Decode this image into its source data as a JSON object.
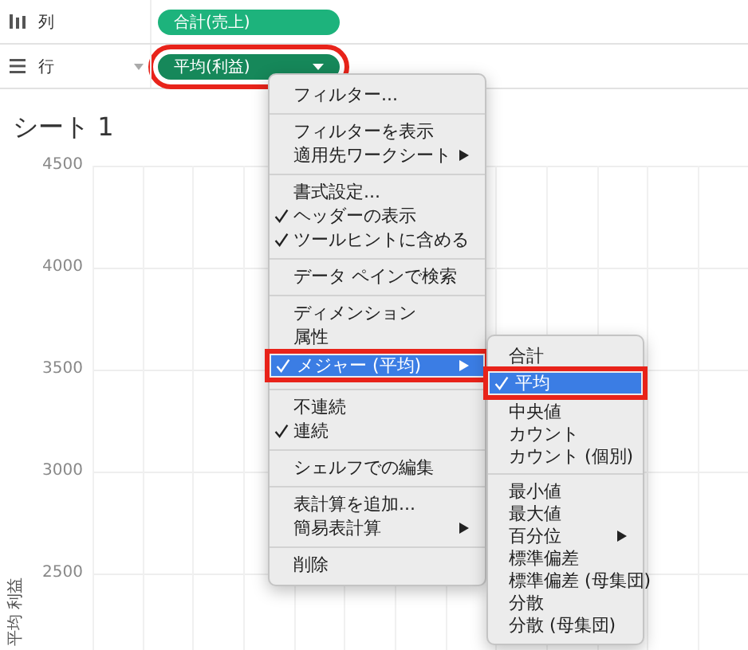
{
  "shelves": [
    {
      "kind": "columns",
      "label": "列",
      "pill": {
        "label": "合計(売上)",
        "dropdown": false,
        "callout": false
      }
    },
    {
      "kind": "rows",
      "label": "行",
      "pill": {
        "label": "平均(利益)",
        "dropdown": true,
        "callout": true
      }
    }
  ],
  "sheet": {
    "title": "シート 1"
  },
  "chart": {
    "y_label": "平均 利益",
    "y_ticks": [
      "4500",
      "4000",
      "3500",
      "3000",
      "2500"
    ]
  },
  "context_menu": {
    "groups": [
      [
        {
          "label": "フィルター...",
          "checked": false,
          "submenu": false,
          "selected": false,
          "callout": false
        }
      ],
      [
        {
          "label": "フィルターを表示",
          "checked": false,
          "submenu": false,
          "selected": false,
          "callout": false
        },
        {
          "label": "適用先ワークシート",
          "checked": false,
          "submenu": true,
          "selected": false,
          "callout": false
        }
      ],
      [
        {
          "label": "書式設定...",
          "checked": false,
          "submenu": false,
          "selected": false,
          "callout": false
        },
        {
          "label": "ヘッダーの表示",
          "checked": true,
          "submenu": false,
          "selected": false,
          "callout": false
        },
        {
          "label": "ツールヒントに含める",
          "checked": true,
          "submenu": false,
          "selected": false,
          "callout": false
        }
      ],
      [
        {
          "label": "データ ペインで検索",
          "checked": false,
          "submenu": false,
          "selected": false,
          "callout": false
        }
      ],
      [
        {
          "label": "ディメンション",
          "checked": false,
          "submenu": false,
          "selected": false,
          "callout": false
        },
        {
          "label": "属性",
          "checked": false,
          "submenu": false,
          "selected": false,
          "callout": false
        },
        {
          "label": "メジャー (平均)",
          "checked": true,
          "submenu": true,
          "selected": true,
          "callout": true
        }
      ],
      [
        {
          "label": "不連続",
          "checked": false,
          "submenu": false,
          "selected": false,
          "callout": false
        },
        {
          "label": "連続",
          "checked": true,
          "submenu": false,
          "selected": false,
          "callout": false
        }
      ],
      [
        {
          "label": "シェルフでの編集",
          "checked": false,
          "submenu": false,
          "selected": false,
          "callout": false
        }
      ],
      [
        {
          "label": "表計算を追加...",
          "checked": false,
          "submenu": false,
          "selected": false,
          "callout": false
        },
        {
          "label": "簡易表計算",
          "checked": false,
          "submenu": true,
          "selected": false,
          "callout": false
        }
      ],
      [
        {
          "label": "削除",
          "checked": false,
          "submenu": false,
          "selected": false,
          "callout": false
        }
      ]
    ]
  },
  "submenu": {
    "groups": [
      [
        {
          "label": "合計",
          "checked": false,
          "submenu": false,
          "selected": false,
          "callout": false
        },
        {
          "label": "平均",
          "checked": true,
          "submenu": false,
          "selected": true,
          "callout": true
        },
        {
          "label": "中央値",
          "checked": false,
          "submenu": false,
          "selected": false,
          "callout": false
        },
        {
          "label": "カウント",
          "checked": false,
          "submenu": false,
          "selected": false,
          "callout": false
        },
        {
          "label": "カウント (個別)",
          "checked": false,
          "submenu": false,
          "selected": false,
          "callout": false
        }
      ],
      [
        {
          "label": "最小値",
          "checked": false,
          "submenu": false,
          "selected": false,
          "callout": false
        },
        {
          "label": "最大値",
          "checked": false,
          "submenu": false,
          "selected": false,
          "callout": false
        },
        {
          "label": "百分位",
          "checked": false,
          "submenu": true,
          "selected": false,
          "callout": false
        },
        {
          "label": "標準偏差",
          "checked": false,
          "submenu": false,
          "selected": false,
          "callout": false
        },
        {
          "label": "標準偏差 (母集団)",
          "checked": false,
          "submenu": false,
          "selected": false,
          "callout": false
        },
        {
          "label": "分散",
          "checked": false,
          "submenu": false,
          "selected": false,
          "callout": false
        },
        {
          "label": "分散 (母集団)",
          "checked": false,
          "submenu": false,
          "selected": false,
          "callout": false
        }
      ]
    ]
  }
}
